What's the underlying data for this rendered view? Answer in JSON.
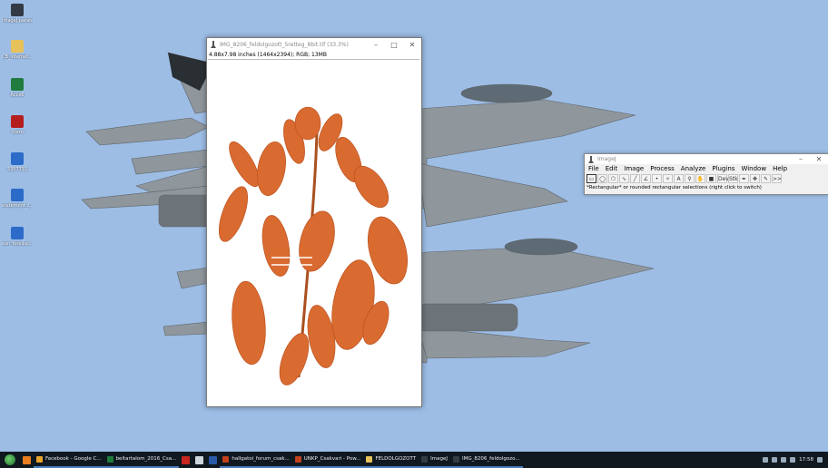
{
  "desktop": {
    "icons": [
      {
        "label": "ImageJ parancsikonja",
        "color": "#333a44"
      },
      {
        "label": "CB_internet...",
        "color": "#e7c25a"
      },
      {
        "label": "Accx6",
        "color": "#1f7b3e"
      },
      {
        "label": "Xtern",
        "color": "#b51e1e"
      },
      {
        "label": "2357791",
        "color": "#2c6bc8"
      },
      {
        "label": "statement_f...",
        "color": "#2c6bc8"
      },
      {
        "label": "sun_fossilisc...",
        "color": "#2c6bc8"
      }
    ]
  },
  "image_window": {
    "title": "IMG_8206_feldolgozott_5retteg_8bit.tif (33.3%)",
    "info": "4.88x7.98 inches (1464x2394); RGB; 13MB",
    "minimize": "–",
    "maximize": "□",
    "close": "✕"
  },
  "imagej": {
    "title": "ImageJ",
    "menu": [
      "File",
      "Edit",
      "Image",
      "Process",
      "Analyze",
      "Plugins",
      "Window",
      "Help"
    ],
    "tools": [
      "rectangle",
      "oval",
      "polygon",
      "freehand",
      "straight-line",
      "angle",
      "point",
      "wand",
      "text",
      "magnifier",
      "hand",
      "color-picker",
      "dev",
      "stk",
      "brush",
      "dropper",
      "pencil",
      "more"
    ],
    "tool_glyphs": [
      "▭",
      "◯",
      "⬠",
      "∿",
      "╱",
      "∠",
      "•",
      "✧",
      "A",
      "⚲",
      "✋",
      "■",
      "Dev",
      "Stk",
      "✒",
      "✤",
      "✎",
      ">>"
    ],
    "status": "*Rectangular* or rounded rectangular selections (right click to switch)",
    "minimize": "–",
    "close": "✕"
  },
  "taskbar": {
    "items": [
      {
        "label": "Facebook - Google C...",
        "color": "#e9a42b"
      },
      {
        "label": "beltartalom_2016_Csa...",
        "color": "#1f7b3e"
      },
      {
        "label": "hallgatoi_forum_csak...",
        "color": "#c2411c"
      },
      {
        "label": "UNKP_Csakvari - Pow...",
        "color": "#c2411c"
      },
      {
        "label": "FELDOLGOZOTT",
        "color": "#e7c25a"
      },
      {
        "label": "ImageJ",
        "color": "#333a44"
      },
      {
        "label": "IMG_8206_feldolgozo...",
        "color": "#333a44"
      }
    ],
    "clock": "17:58"
  },
  "colors": {
    "sky": "#9bbce4",
    "taskbar": "#101820",
    "leaf": "#d96a30"
  }
}
